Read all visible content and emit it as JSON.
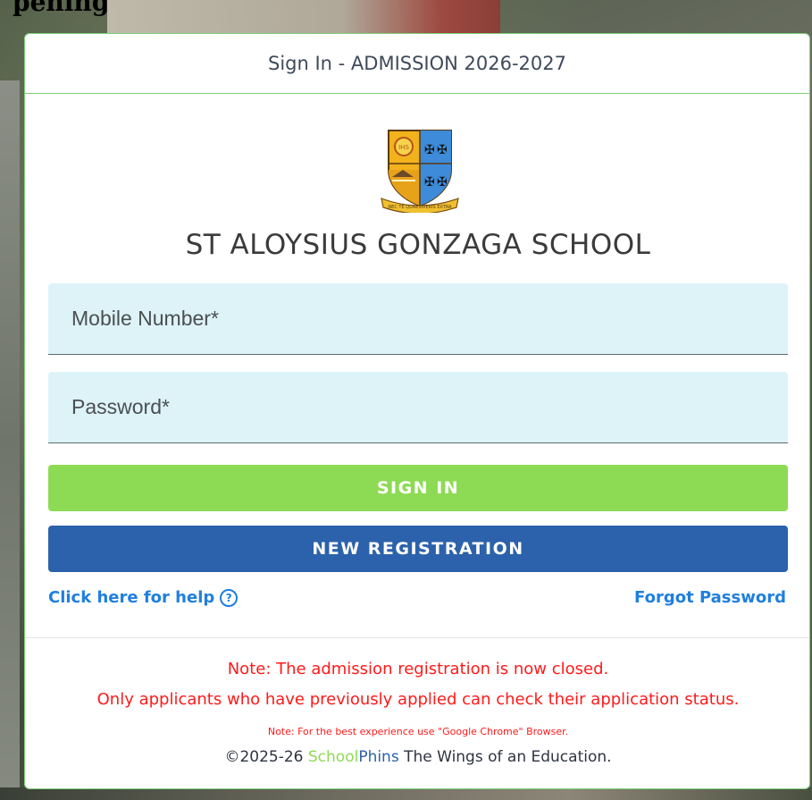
{
  "background": {
    "heading": "pening"
  },
  "header": {
    "title": "Sign In - ADMISSION 2026-2027"
  },
  "crest": {
    "icon": "school-crest-icon",
    "motto": "NEC TE QUAESIVERIS EXTRA"
  },
  "school": {
    "name": "ST ALOYSIUS GONZAGA SCHOOL"
  },
  "form": {
    "mobile_placeholder": "Mobile Number*",
    "mobile_value": "",
    "password_placeholder": "Password*",
    "password_value": ""
  },
  "buttons": {
    "signin_label": "SIGN IN",
    "register_label": "NEW REGISTRATION"
  },
  "links": {
    "help_label": "Click here for help",
    "help_icon": "question-circle-icon",
    "forgot_label": "Forgot Password"
  },
  "notes": {
    "line1": "Note: The admission registration is now closed.",
    "line2": "Only applicants who have previously applied can check their application status.",
    "line3": "Note: For the best experience use \"Google Chrome\" Browser."
  },
  "footer": {
    "prefix": "©2025-26 ",
    "brand_school": "School",
    "brand_phins": "Phins",
    "suffix": " The Wings of an Education."
  },
  "colors": {
    "signin": "#8ddb54",
    "register": "#2b62ab",
    "link": "#1f7fe0",
    "notice": "#ff1a1a",
    "field_bg": "#ddf3f8"
  }
}
